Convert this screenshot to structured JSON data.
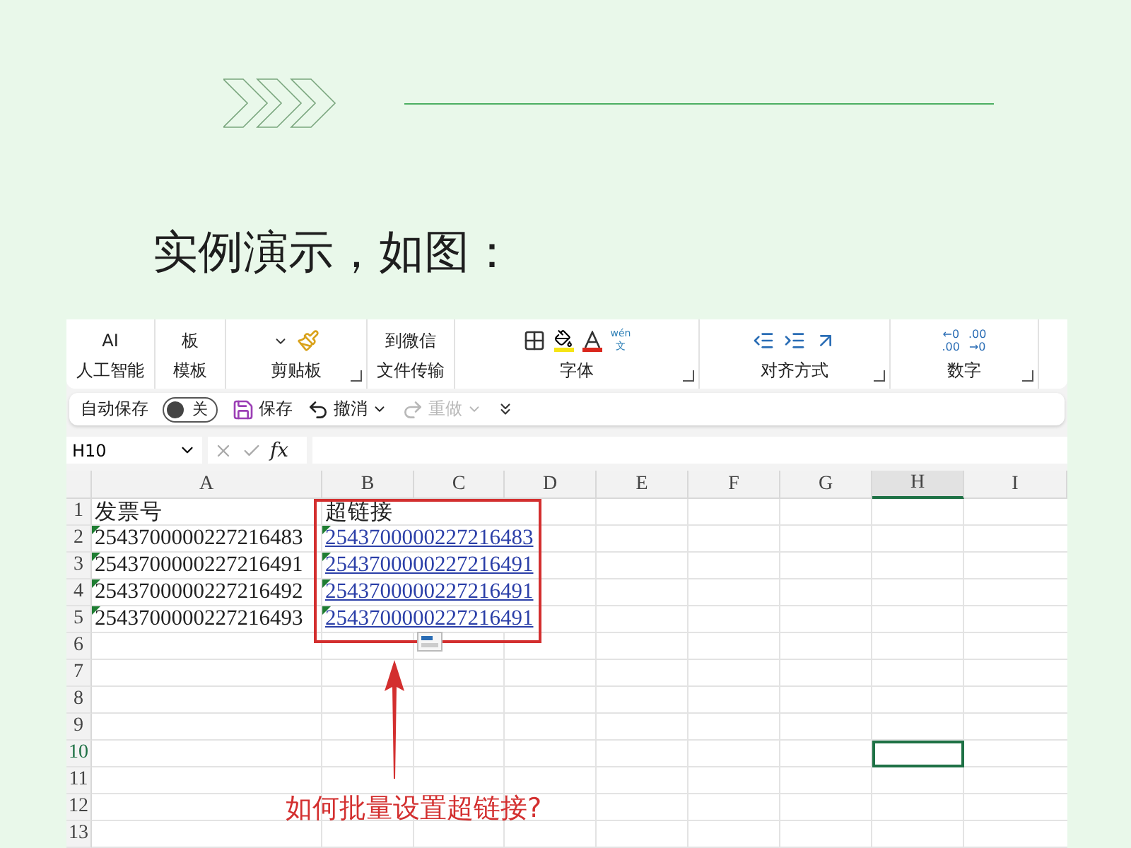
{
  "section_heading": "实例演示，如图：",
  "ribbon": {
    "groups": [
      {
        "kind": "ai",
        "label": "人工智能",
        "top": "AI"
      },
      {
        "kind": "text",
        "label": "模板",
        "top": "板"
      },
      {
        "kind": "clipboard",
        "label": "剪贴板",
        "launcher": true
      },
      {
        "kind": "text",
        "label": "文件传输",
        "top": "到微信"
      },
      {
        "kind": "font",
        "label": "字体",
        "launcher": true,
        "phonetic_top": "wén",
        "phonetic_bottom": "文"
      },
      {
        "kind": "align",
        "label": "对齐方式",
        "launcher": true
      },
      {
        "kind": "number",
        "label": "数字",
        "launcher": true,
        "decimals": [
          {
            "top": "←0",
            "bottom": ".00"
          },
          {
            "top": ".00",
            "bottom": "→0"
          }
        ]
      }
    ]
  },
  "quick_access": {
    "autosave_label": "自动保存",
    "autosave": {
      "on": false,
      "label": "关"
    },
    "save": "保存",
    "undo": "撤消",
    "redo": {
      "label": "重做",
      "disabled": true
    }
  },
  "formula_bar": {
    "name_box": "H10",
    "fx": "fx"
  },
  "sheet": {
    "columns": [
      {
        "label": "A",
        "selected": false
      },
      {
        "label": "B",
        "selected": false
      },
      {
        "label": "C",
        "selected": false
      },
      {
        "label": "D",
        "selected": false
      },
      {
        "label": "E",
        "selected": false
      },
      {
        "label": "F",
        "selected": false
      },
      {
        "label": "G",
        "selected": false
      },
      {
        "label": "H",
        "selected": true
      },
      {
        "label": "I",
        "selected": false
      }
    ],
    "rows": [
      {
        "number": "1",
        "selected": false,
        "cells": [
          {
            "text": "发票号",
            "kind": "text",
            "flag": false
          },
          {
            "text": "超链接",
            "kind": "text",
            "flag": false
          }
        ]
      },
      {
        "number": "2",
        "selected": false,
        "cells": [
          {
            "text": "2543700000227216483",
            "kind": "text",
            "flag": true
          },
          {
            "text": "2543700000227216483",
            "kind": "link",
            "flag": true
          }
        ]
      },
      {
        "number": "3",
        "selected": false,
        "cells": [
          {
            "text": "2543700000227216491",
            "kind": "text",
            "flag": true
          },
          {
            "text": "2543700000227216491",
            "kind": "link",
            "flag": true
          }
        ]
      },
      {
        "number": "4",
        "selected": false,
        "cells": [
          {
            "text": "2543700000227216492",
            "kind": "text",
            "flag": true
          },
          {
            "text": "2543700000227216491",
            "kind": "link",
            "flag": true
          }
        ]
      },
      {
        "number": "5",
        "selected": false,
        "cells": [
          {
            "text": "2543700000227216493",
            "kind": "text",
            "flag": true
          },
          {
            "text": "2543700000227216491",
            "kind": "link",
            "flag": true
          }
        ]
      },
      {
        "number": "6",
        "selected": false
      },
      {
        "number": "7",
        "selected": false
      },
      {
        "number": "8",
        "selected": false
      },
      {
        "number": "9",
        "selected": false
      },
      {
        "number": "10",
        "selected": true
      },
      {
        "number": "11",
        "selected": false
      },
      {
        "number": "12",
        "selected": false
      },
      {
        "number": "13",
        "selected": false
      }
    ]
  },
  "annotation": "如何批量设置超链接?"
}
